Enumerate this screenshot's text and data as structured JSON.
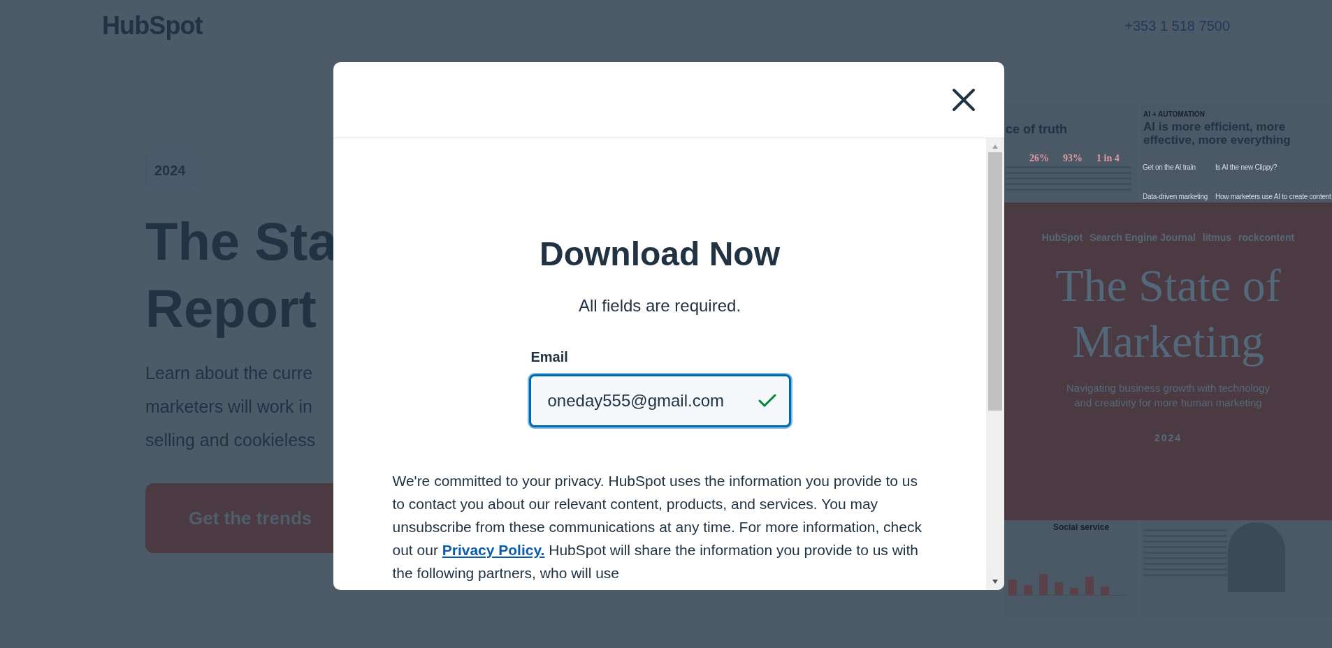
{
  "header": {
    "logo": "HubSpot",
    "phone": "+353 1 518 7500"
  },
  "hero": {
    "badge": "2024",
    "title_lines": [
      "The Sta",
      "Report"
    ],
    "description_lines": [
      "Learn about the curre",
      "marketers will work in",
      "selling and cookieless"
    ],
    "cta": "Get the trends"
  },
  "report_preview": {
    "left_page": {
      "heading": "ce of truth",
      "stats": [
        "26%",
        "93%",
        "1 in 4"
      ]
    },
    "right_page": {
      "eyebrow": "AI + AUTOMATION",
      "heading": "AI is more efficient, more effective, more everything",
      "subheads": [
        "Get on the AI train",
        "Is AI the new Clippy?",
        "Data-driven marketing",
        "How marketers use AI to create content"
      ]
    },
    "lower_left": {
      "subhead": "Social service"
    },
    "cover": {
      "partner_logos": [
        "HubSpot",
        "Search Engine Journal",
        "litmus",
        "rockcontent"
      ],
      "title_lines": [
        "The State of",
        "Marketing"
      ],
      "subtitle_lines": [
        "Navigating business growth with technology",
        "and creativity for more human marketing"
      ],
      "year": "2024"
    }
  },
  "modal": {
    "title": "Download Now",
    "note": "All fields are required.",
    "email_field": {
      "label": "Email",
      "value": "oneday555@gmail.com",
      "valid": true
    },
    "privacy": {
      "before": "We're committed to your privacy. HubSpot uses the information you provide to us to contact you about our relevant content, products, and services. You may unsubscribe from these communications at any time. For more information, check out our",
      "link": "Privacy Policy.",
      "after": "HubSpot will share the information you provide to us with the following partners, who will use"
    }
  }
}
